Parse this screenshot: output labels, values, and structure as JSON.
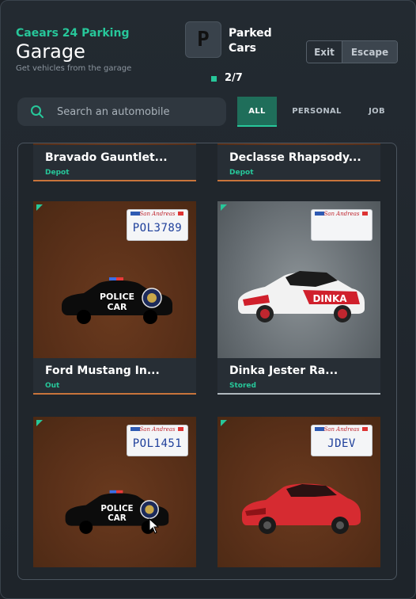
{
  "header": {
    "brand": "Caears 24 Parking",
    "title": "Garage",
    "subtitle": "Get vehicles from the garage",
    "badge_letter": "P",
    "parked_line1": "Parked",
    "parked_line2": "Cars",
    "exit_label": "Exit",
    "escape_label": "Escape",
    "count": "2/7"
  },
  "search": {
    "placeholder": "Search an automobile"
  },
  "tabs": [
    {
      "label": "ALL",
      "active": true
    },
    {
      "label": "PERSONAL",
      "active": false
    },
    {
      "label": "JOB",
      "active": false
    }
  ],
  "vehicles": [
    {
      "name": "Bravado Gauntlet...",
      "status": "Depot",
      "plate_state": "",
      "plate": ""
    },
    {
      "name": "Declasse Rhapsody...",
      "status": "Depot",
      "plate_state": "",
      "plate": ""
    },
    {
      "name": "Ford Mustang In...",
      "status": "Out",
      "plate_state": "San Andreas",
      "plate": "POL3789",
      "decal": "POLICE CAR"
    },
    {
      "name": "Dinka Jester Ra...",
      "status": "Stored",
      "plate_state": "San Andreas",
      "plate": "",
      "decal": "DINKA"
    },
    {
      "name": "",
      "status": "",
      "plate_state": "San Andreas",
      "plate": "POL1451",
      "decal": "POLICE CAR"
    },
    {
      "name": "",
      "status": "",
      "plate_state": "San Andreas",
      "plate": "JDEV"
    }
  ],
  "colors": {
    "accent": "#27c79a",
    "card_brown": "#5a3019",
    "status_green": "#27c79a",
    "plate_blue": "#1e3f9b",
    "plate_red": "#c0262f"
  }
}
